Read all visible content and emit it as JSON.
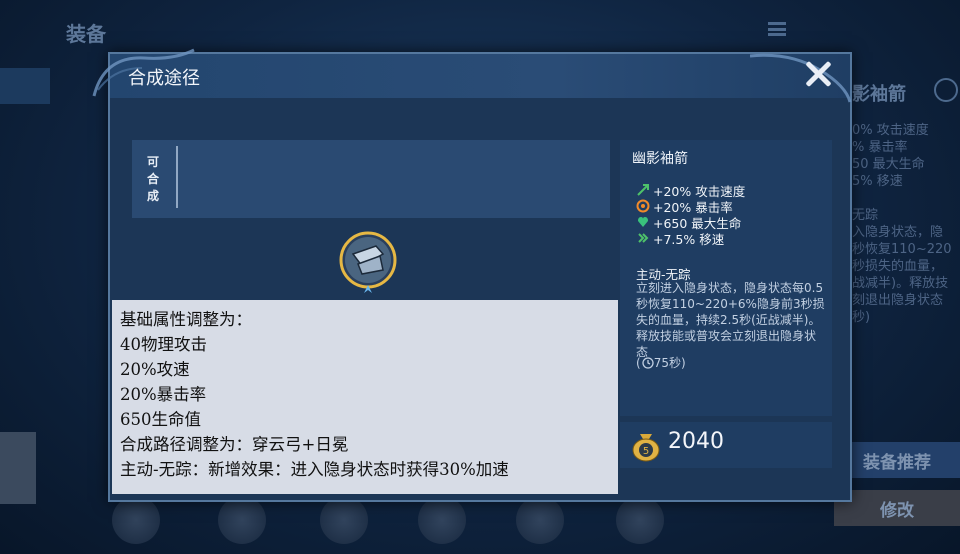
{
  "background": {
    "title": "装备",
    "right_title": "影袖箭",
    "right_stats": "0% 攻击速度\n% 暴击率\n50 最大生命\n5% 移速\n\n无踪\n入隐身状态，隐\n秒恢复110~220\n秒损失的血量，\n战减半)。释放技\n刻退出隐身状态\n秒)",
    "recommend_label": "装备推荐",
    "modify_label": "修改"
  },
  "dialog": {
    "title": "合成途径",
    "craft_label": "可合成"
  },
  "item": {
    "name": "幽影袖箭",
    "stats": [
      {
        "icon": "attack-speed-icon",
        "text": "+20% 攻击速度",
        "color": "#4ec26a"
      },
      {
        "icon": "crit-icon",
        "text": "+20% 暴击率",
        "color": "#f08a2a"
      },
      {
        "icon": "health-icon",
        "text": "+650 最大生命",
        "color": "#39c27c"
      },
      {
        "icon": "move-speed-icon",
        "text": "+7.5% 移速",
        "color": "#4ec26a"
      }
    ],
    "active_title": "主动-无踪",
    "active_desc": "立刻进入隐身状态，隐身状态每0.5秒恢复110~220+6%隐身前3秒损失的血量，持续2.5秒(近战减半)。释放技能或普攻会立刻退出隐身状态",
    "cooldown": "75秒",
    "price": "2040"
  },
  "overlay_lines": [
    "基础属性调整为：",
    "40物理攻击",
    "20%攻速",
    "20%暴击率",
    "650生命值",
    "合成路径调整为：穿云弓+日冕",
    "主动-无踪：新增效果：进入隐身状态时获得30%加速"
  ]
}
